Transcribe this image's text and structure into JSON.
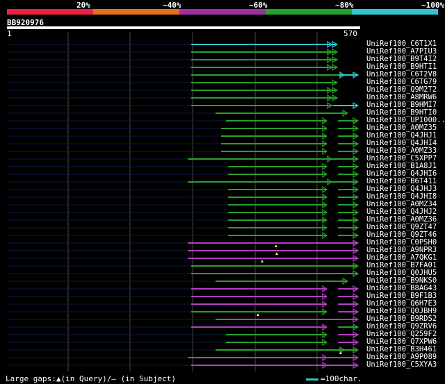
{
  "query": {
    "name": "BB920976",
    "start": "1",
    "end": "570",
    "length": 570
  },
  "legend": [
    {
      "label": "20%",
      "color": "#e8253d"
    },
    {
      "label": "~40%",
      "color": "#e07020"
    },
    {
      "label": "~60%",
      "color": "#a02ea5"
    },
    {
      "label": "~80%",
      "color": "#2aa02a"
    },
    {
      "label": "~100%",
      "color": "#2ec7d1"
    }
  ],
  "colors": {
    "cyan": "#2ec7d1",
    "green": "#2aa02a",
    "magenta": "#b23fc0",
    "gap": "#0b1a4a",
    "grid": "#7b7b7b",
    "marker": "#f5f070"
  },
  "rows": [
    {
      "label": "UniRef100_C6T1X1",
      "segs": [
        [
          0,
          265,
          "gap"
        ],
        [
          265,
          475,
          "cyan"
        ]
      ],
      "arrows": [
        [
          475,
          "cyan"
        ],
        [
          475,
          "cyan"
        ]
      ],
      "mid": [
        [
          467,
          "cyan"
        ]
      ]
    },
    {
      "label": "UniRef100_A7PIU3",
      "segs": [
        [
          0,
          265,
          "gap"
        ],
        [
          265,
          475,
          "green"
        ]
      ],
      "mid": [
        [
          467,
          "green"
        ],
        [
          485,
          "green"
        ]
      ]
    },
    {
      "label": "UniRef100_B9T4I2",
      "segs": [
        [
          0,
          265,
          "gap"
        ],
        [
          265,
          475,
          "green"
        ]
      ],
      "mid": [
        [
          467,
          "green"
        ],
        [
          485,
          "green"
        ]
      ]
    },
    {
      "label": "UniRef100_B9HTI1",
      "segs": [
        [
          0,
          265,
          "gap"
        ],
        [
          265,
          475,
          "green"
        ]
      ],
      "mid": [
        [
          467,
          "green"
        ],
        [
          485,
          "green"
        ]
      ]
    },
    {
      "label": "UniRef100_C6T2V8",
      "segs": [
        [
          0,
          265,
          "gap"
        ],
        [
          265,
          478,
          "green"
        ],
        [
          478,
          505,
          "cyan"
        ]
      ],
      "mid": [
        [
          485,
          "cyan"
        ]
      ]
    },
    {
      "label": "UniRef100_C6TG79",
      "segs": [
        [
          0,
          265,
          "gap"
        ],
        [
          265,
          475,
          "green"
        ]
      ],
      "mid": [
        [
          485,
          "green"
        ]
      ]
    },
    {
      "label": "UniRef100_Q9M2T2",
      "segs": [
        [
          0,
          265,
          "gap"
        ],
        [
          265,
          475,
          "green"
        ]
      ],
      "mid": [
        [
          467,
          "green"
        ],
        [
          485,
          "green"
        ]
      ]
    },
    {
      "label": "UniRef100_A8MRW6",
      "segs": [
        [
          0,
          265,
          "gap"
        ],
        [
          265,
          475,
          "green"
        ]
      ],
      "mid": [
        [
          467,
          "green"
        ],
        [
          485,
          "green"
        ]
      ]
    },
    {
      "label": "UniRef100_B9HMI7",
      "segs": [
        [
          0,
          265,
          "gap"
        ],
        [
          265,
          470,
          "green"
        ],
        [
          470,
          505,
          "cyan"
        ]
      ],
      "mid": [
        [
          467,
          "green"
        ]
      ]
    },
    {
      "label": "UniRef100_B9HTI0",
      "segs": [
        [
          0,
          300,
          "gap"
        ],
        [
          300,
          490,
          "green"
        ]
      ],
      "mid": []
    },
    {
      "label": "UniRef100_UPI000..",
      "segs": [
        [
          0,
          315,
          "gap"
        ],
        [
          315,
          460,
          "green"
        ],
        [
          476,
          505,
          "green"
        ]
      ],
      "mid": [
        [
          460,
          "green"
        ]
      ]
    },
    {
      "label": "UniRef100_A0MZ35",
      "segs": [
        [
          0,
          308,
          "gap"
        ],
        [
          308,
          460,
          "green"
        ],
        [
          476,
          505,
          "green"
        ]
      ],
      "mid": [
        [
          460,
          "green"
        ]
      ]
    },
    {
      "label": "UniRef100_Q4JHJ1",
      "segs": [
        [
          0,
          308,
          "gap"
        ],
        [
          308,
          460,
          "green"
        ],
        [
          476,
          505,
          "green"
        ]
      ],
      "mid": [
        [
          460,
          "green"
        ]
      ]
    },
    {
      "label": "UniRef100_Q4JHI4",
      "segs": [
        [
          0,
          308,
          "gap"
        ],
        [
          308,
          460,
          "green"
        ],
        [
          476,
          505,
          "green"
        ]
      ],
      "mid": [
        [
          460,
          "green"
        ]
      ]
    },
    {
      "label": "UniRef100_A0MZ33",
      "segs": [
        [
          0,
          308,
          "gap"
        ],
        [
          308,
          460,
          "green"
        ],
        [
          476,
          505,
          "green"
        ]
      ],
      "mid": [
        [
          460,
          "green"
        ]
      ]
    },
    {
      "label": "UniRef100_C5XPP7",
      "segs": [
        [
          0,
          260,
          "gap"
        ],
        [
          260,
          505,
          "green"
        ]
      ],
      "mid": [
        [
          467,
          "green"
        ]
      ]
    },
    {
      "label": "UniRef100_B1A8J1",
      "segs": [
        [
          0,
          318,
          "gap"
        ],
        [
          318,
          460,
          "green"
        ],
        [
          476,
          505,
          "green"
        ]
      ],
      "mid": [
        [
          460,
          "green"
        ]
      ]
    },
    {
      "label": "UniRef100_Q4JHI6",
      "segs": [
        [
          0,
          318,
          "gap"
        ],
        [
          318,
          460,
          "green"
        ],
        [
          476,
          505,
          "green"
        ]
      ],
      "mid": [
        [
          460,
          "green"
        ]
      ]
    },
    {
      "label": "UniRef100_B6T411",
      "segs": [
        [
          0,
          260,
          "gap"
        ],
        [
          260,
          505,
          "green"
        ]
      ],
      "mid": [
        [
          467,
          "green"
        ]
      ]
    },
    {
      "label": "UniRef100_Q4JHJ3",
      "segs": [
        [
          0,
          318,
          "gap"
        ],
        [
          318,
          460,
          "green"
        ],
        [
          476,
          505,
          "green"
        ]
      ],
      "mid": [
        [
          460,
          "green"
        ]
      ]
    },
    {
      "label": "UniRef100_Q4JHI8",
      "segs": [
        [
          0,
          318,
          "gap"
        ],
        [
          318,
          460,
          "green"
        ],
        [
          476,
          505,
          "green"
        ]
      ],
      "mid": [
        [
          460,
          "green"
        ]
      ]
    },
    {
      "label": "UniRef100_A0MZ34",
      "segs": [
        [
          0,
          318,
          "gap"
        ],
        [
          318,
          460,
          "green"
        ],
        [
          476,
          505,
          "green"
        ]
      ],
      "mid": [
        [
          460,
          "green"
        ]
      ]
    },
    {
      "label": "UniRef100_Q4JHJ2",
      "segs": [
        [
          0,
          318,
          "gap"
        ],
        [
          318,
          460,
          "green"
        ],
        [
          476,
          505,
          "green"
        ]
      ],
      "mid": [
        [
          460,
          "green"
        ]
      ]
    },
    {
      "label": "UniRef100_A0MZ36",
      "segs": [
        [
          0,
          318,
          "gap"
        ],
        [
          318,
          460,
          "green"
        ],
        [
          476,
          505,
          "green"
        ]
      ],
      "mid": [
        [
          460,
          "green"
        ]
      ]
    },
    {
      "label": "UniRef100_Q9ZT47",
      "segs": [
        [
          0,
          318,
          "gap"
        ],
        [
          318,
          460,
          "green"
        ],
        [
          476,
          505,
          "green"
        ]
      ],
      "mid": [
        [
          460,
          "green"
        ]
      ]
    },
    {
      "label": "UniRef100_Q9ZT46",
      "segs": [
        [
          0,
          318,
          "gap"
        ],
        [
          318,
          460,
          "green"
        ],
        [
          476,
          505,
          "green"
        ]
      ],
      "mid": [
        [
          460,
          "green"
        ]
      ]
    },
    {
      "label": "UniRef100_C0PSH0",
      "segs": [
        [
          0,
          260,
          "gap"
        ],
        [
          260,
          505,
          "magenta"
        ]
      ],
      "mid": [
        [
          505,
          "magenta"
        ]
      ]
    },
    {
      "label": "UniRef100_A9NPR3",
      "segs": [
        [
          0,
          260,
          "gap"
        ],
        [
          260,
          505,
          "magenta"
        ]
      ],
      "mid": [
        [
          505,
          "magenta"
        ]
      ]
    },
    {
      "label": "UniRef100_A7QKG1",
      "segs": [
        [
          0,
          260,
          "gap"
        ],
        [
          260,
          505,
          "magenta"
        ]
      ],
      "mid": [
        [
          505,
          "magenta"
        ]
      ]
    },
    {
      "label": "UniRef100_B7FA01",
      "segs": [
        [
          0,
          265,
          "gap"
        ],
        [
          265,
          505,
          "green"
        ]
      ],
      "mid": [
        [
          505,
          "green"
        ]
      ]
    },
    {
      "label": "UniRef100_Q0JHU5",
      "segs": [
        [
          0,
          265,
          "gap"
        ],
        [
          265,
          505,
          "green"
        ]
      ],
      "mid": [
        [
          505,
          "green"
        ]
      ]
    },
    {
      "label": "UniRef100_B9NKS0",
      "segs": [
        [
          0,
          300,
          "gap"
        ],
        [
          300,
          490,
          "green"
        ]
      ],
      "mid": [
        [
          490,
          "green"
        ]
      ]
    },
    {
      "label": "UniRef100_B8AG43",
      "segs": [
        [
          0,
          265,
          "gap"
        ],
        [
          265,
          460,
          "magenta"
        ],
        [
          476,
          505,
          "magenta"
        ]
      ],
      "mid": [
        [
          460,
          "magenta"
        ]
      ]
    },
    {
      "label": "UniRef100_B9F1B3",
      "segs": [
        [
          0,
          265,
          "gap"
        ],
        [
          265,
          460,
          "magenta"
        ],
        [
          476,
          505,
          "magenta"
        ]
      ],
      "mid": [
        [
          460,
          "magenta"
        ]
      ]
    },
    {
      "label": "UniRef100_Q6H7E3",
      "segs": [
        [
          0,
          265,
          "gap"
        ],
        [
          265,
          460,
          "magenta"
        ],
        [
          476,
          505,
          "magenta"
        ]
      ],
      "mid": [
        [
          460,
          "magenta"
        ]
      ]
    },
    {
      "label": "UniRef100_Q0JBH9",
      "segs": [
        [
          0,
          265,
          "gap"
        ],
        [
          265,
          460,
          "green"
        ],
        [
          476,
          505,
          "magenta"
        ]
      ],
      "mid": [
        [
          460,
          "green"
        ]
      ]
    },
    {
      "label": "UniRef100_B9RDS2",
      "segs": [
        [
          0,
          300,
          "gap"
        ],
        [
          300,
          505,
          "magenta"
        ]
      ],
      "mid": [
        [
          505,
          "magenta"
        ]
      ]
    },
    {
      "label": "UniRef100_Q9ZRV6",
      "segs": [
        [
          0,
          265,
          "gap"
        ],
        [
          265,
          460,
          "magenta"
        ],
        [
          476,
          505,
          "green"
        ]
      ],
      "mid": [
        [
          460,
          "magenta"
        ]
      ]
    },
    {
      "label": "UniRef100_Q259F2",
      "segs": [
        [
          0,
          315,
          "gap"
        ],
        [
          315,
          460,
          "green"
        ],
        [
          476,
          505,
          "magenta"
        ]
      ],
      "mid": [
        [
          460,
          "green"
        ]
      ]
    },
    {
      "label": "UniRef100_Q7XPW6",
      "segs": [
        [
          0,
          315,
          "gap"
        ],
        [
          315,
          460,
          "green"
        ],
        [
          476,
          505,
          "magenta"
        ]
      ],
      "mid": [
        [
          460,
          "green"
        ]
      ]
    },
    {
      "label": "UniRef100_B3H461",
      "segs": [
        [
          0,
          300,
          "gap"
        ],
        [
          300,
          505,
          "green"
        ]
      ],
      "mid": [
        [
          485,
          "green"
        ]
      ]
    },
    {
      "label": "UniRef100_A9P089",
      "segs": [
        [
          0,
          260,
          "gap"
        ],
        [
          260,
          505,
          "magenta"
        ]
      ],
      "mid": [
        [
          460,
          "magenta"
        ]
      ]
    },
    {
      "label": "UniRef100_C5XYA3",
      "segs": [
        [
          0,
          265,
          "gap"
        ],
        [
          265,
          505,
          "magenta"
        ]
      ],
      "mid": [
        [
          460,
          "magenta"
        ]
      ]
    }
  ],
  "footer": {
    "left": "Large gaps:▲(in Query)/– (in Subject)",
    "right": "=100char."
  }
}
